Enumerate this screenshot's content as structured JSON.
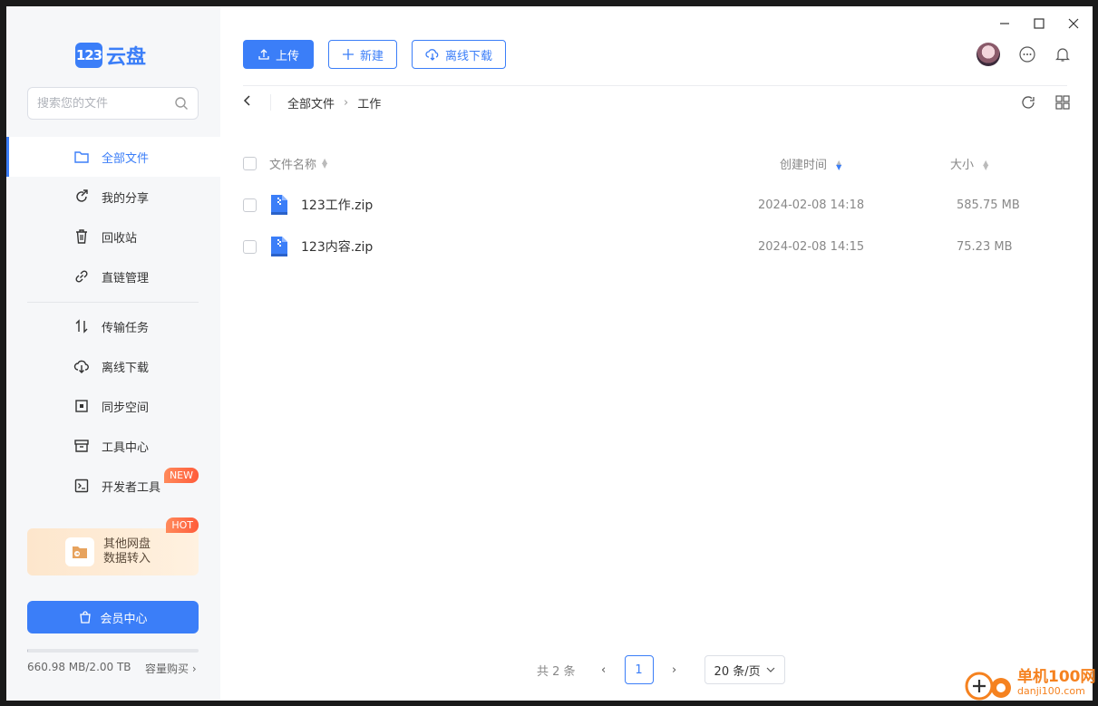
{
  "app": {
    "logo_mark": "123",
    "logo_text": "云盘"
  },
  "search": {
    "placeholder": "搜索您的文件"
  },
  "nav": {
    "all_files": "全部文件",
    "my_share": "我的分享",
    "recycle_bin": "回收站",
    "direct_link": "直链管理",
    "transfers": "传输任务",
    "offline_download": "离线下载",
    "sync_space": "同步空间",
    "tools": "工具中心",
    "developer_tools": "开发者工具",
    "new_badge": "NEW"
  },
  "promo": {
    "line1": "其他网盘",
    "line2": "数据转入",
    "hot_badge": "HOT"
  },
  "vip": {
    "label": "会员中心"
  },
  "storage": {
    "used_text": "660.98 MB/2.00 TB",
    "used_fraction": 0.0003,
    "buy_label": "容量购买"
  },
  "toolbar": {
    "upload": "上传",
    "new": "新建",
    "offline": "离线下载"
  },
  "breadcrumb": {
    "root": "全部文件",
    "current": "工作"
  },
  "table": {
    "columns": {
      "name": "文件名称",
      "created": "创建时间",
      "size": "大小"
    },
    "rows": [
      {
        "name": "123工作.zip",
        "created": "2024-02-08 14:18",
        "size": "585.75 MB"
      },
      {
        "name": "123内容.zip",
        "created": "2024-02-08 14:15",
        "size": "75.23 MB"
      }
    ]
  },
  "pager": {
    "total": "共 2 条",
    "current_page": "1",
    "page_size": "20 条/页"
  },
  "watermark": {
    "title": "单机100网",
    "sub": "danji100.com"
  },
  "colors": {
    "accent": "#3b7ef8",
    "badge": "#ff5c3b"
  }
}
